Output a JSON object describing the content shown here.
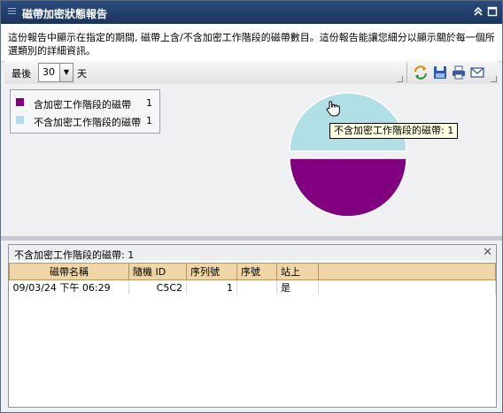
{
  "window": {
    "title": "磁帶加密狀態報告"
  },
  "description": "這份報告中顯示在指定的期間, 磁帶上含/不含加密工作階段的磁帶數目。這份報告能讓您細分以顯示關於每一個所選類別的詳細資訊。",
  "toolbar": {
    "last_label": "最後",
    "days_value": "30",
    "days_unit": "天",
    "tools": [
      "refresh-icon",
      "save-icon",
      "print-icon",
      "email-icon"
    ]
  },
  "chart_data": {
    "type": "pie",
    "categories": [
      "含加密工作階段的磁帶",
      "不含加密工作階段的磁帶"
    ],
    "values": [
      1,
      1
    ],
    "colors": [
      "#800080",
      "#b0e0e6"
    ],
    "legend_counts": [
      "1",
      "1"
    ],
    "exploded": "不含加密工作階段的磁帶",
    "tooltip": "不含加密工作階段的磁帶: 1",
    "legend": "top-left"
  },
  "details": {
    "title": "不含加密工作階段的磁帶: 1",
    "columns": [
      "磁帶名稱",
      "隨機 ID",
      "序列號",
      "序號",
      "站上"
    ],
    "rows": [
      [
        "09/03/24 下午 06:29",
        "C5C2",
        "1",
        "",
        "是"
      ]
    ]
  }
}
